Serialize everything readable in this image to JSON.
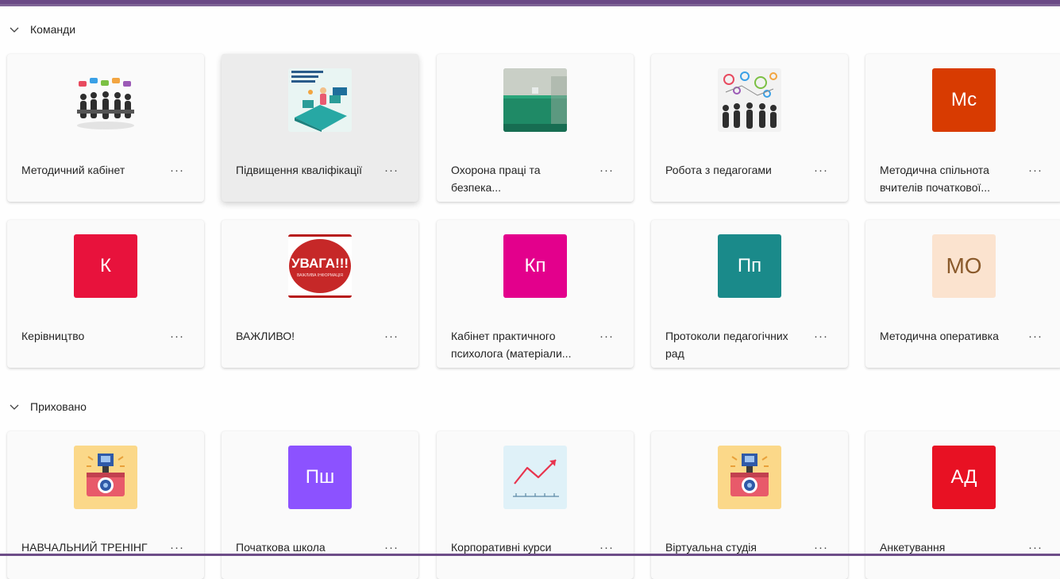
{
  "sections": {
    "teams_label": "Команди",
    "hidden_label": "Приховано"
  },
  "more_label": "···",
  "teams": [
    {
      "name": "Методичний кабінет",
      "icon": "people-meeting-photo"
    },
    {
      "name": "Підвищення кваліфікації",
      "icon": "classroom-illustration"
    },
    {
      "name": "Охорона праці та безпека...",
      "icon": "green-room-photo"
    },
    {
      "name": "Робота з педагогами",
      "icon": "teamwork-gears-photo"
    },
    {
      "name": "Методична спільнота вчителів початкової...",
      "initials": "Мс",
      "color": "#d83b01"
    },
    {
      "name": "Керівництво",
      "initials": "К",
      "color": "#e8123c"
    },
    {
      "name": "ВАЖЛИВО!",
      "icon": "attention-badge",
      "badge_text": "УВАГА!!!",
      "badge_sub": "ВАЖЛИВА ІНФОРМАЦІЯ"
    },
    {
      "name": "Кабінет практичного психолога (матеріали...",
      "initials": "Кп",
      "color": "#e3008c"
    },
    {
      "name": "Протоколи педагогічних рад",
      "initials": "Пп",
      "color": "#1a8a8a"
    },
    {
      "name": "Методична оперативка",
      "initials": "МО",
      "color": "#fbe3cf",
      "text_color": "#8a5a2b"
    }
  ],
  "hidden": [
    {
      "name": "НАВЧАЛЬНИЙ ТРЕНІНГ",
      "icon": "camera-icon"
    },
    {
      "name": "Початкова школа",
      "initials": "Пш",
      "color": "#8c52ff"
    },
    {
      "name": "Корпоративні курси",
      "icon": "trend-chart-icon"
    },
    {
      "name": "Віртуальна студія",
      "icon": "camera-icon"
    },
    {
      "name": "Анкетування",
      "initials": "АД",
      "color": "#e81123"
    }
  ]
}
